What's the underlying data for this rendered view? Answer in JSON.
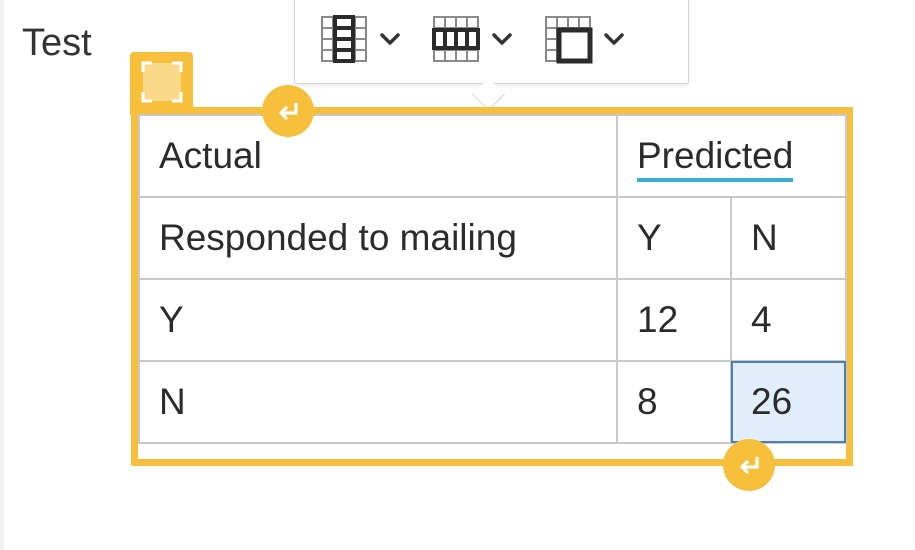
{
  "document": {
    "text_before": "Test"
  },
  "toolbar": {
    "items": [
      {
        "icon": "table-column-icon",
        "dropdown": "chevron-down-icon"
      },
      {
        "icon": "table-row-icon",
        "dropdown": "chevron-down-icon"
      },
      {
        "icon": "merge-cells-icon",
        "dropdown": "chevron-down-icon"
      }
    ]
  },
  "widget": {
    "selection_handle_icon": "table-select-handle-icon",
    "insert_paragraph_icon": "return-arrow-icon",
    "accent_color": "#f7c03c"
  },
  "table": {
    "header": {
      "label_col": "Actual",
      "predicted": "Predicted"
    },
    "subheader": {
      "label_col": "Responded to mailing",
      "y": "Y",
      "n": "N"
    },
    "rows": [
      {
        "label": "Y",
        "y": "12",
        "n": "4"
      },
      {
        "label": "N",
        "y": "8",
        "n": "26"
      }
    ],
    "selected_cell_color": "#e3eefc",
    "spellcheck_underline_color": "#3aaed0"
  }
}
